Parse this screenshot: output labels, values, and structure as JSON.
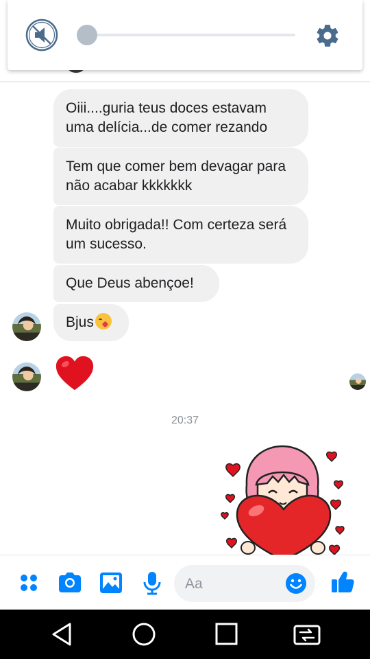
{
  "player": {
    "mute_icon": "speaker-muted-icon",
    "progress": 0.0,
    "settings_icon": "gear-icon"
  },
  "messages": [
    "Oiii....guria teus doces estavam uma delícia...de comer rezando",
    "Tem que comer bem devagar para não acabar kkkkkkk",
    "Muito obrigada!! Com certeza será um sucesso.",
    "Que Deus abençoe!",
    "Bjus"
  ],
  "heart_reaction": "red-heart-emoji",
  "timestamp": "20:37",
  "sticker": "girl-holding-heart-sticker",
  "composer": {
    "placeholder": "Aa",
    "icons": [
      "menu-dots-icon",
      "camera-icon",
      "gallery-icon",
      "microphone-icon",
      "emoji-icon",
      "thumbs-up-icon"
    ]
  },
  "colors": {
    "accent": "#0084ff",
    "bubble": "#f1f0f0",
    "heart": "#e0121f"
  },
  "android_nav": [
    "back-icon",
    "home-icon",
    "recents-icon",
    "screen-switch-icon"
  ]
}
